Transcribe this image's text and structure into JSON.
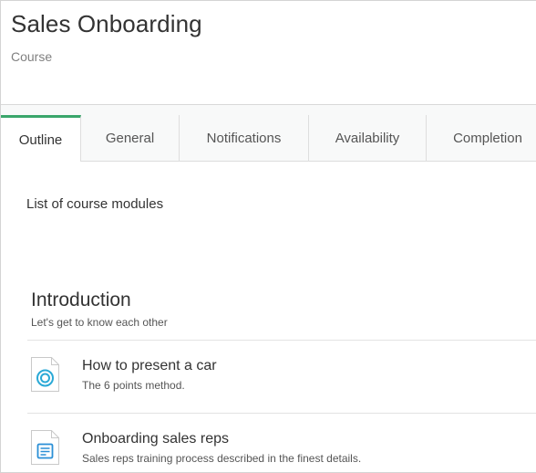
{
  "header": {
    "title": "Sales Onboarding",
    "subtitle": "Course"
  },
  "tabs": [
    {
      "label": "Outline",
      "active": true
    },
    {
      "label": "General",
      "active": false
    },
    {
      "label": "Notifications",
      "active": false
    },
    {
      "label": "Availability",
      "active": false
    },
    {
      "label": "Completion",
      "active": false
    }
  ],
  "colors": {
    "active_tab_accent": "#3aa66b",
    "icon_accent": "#2aa9d6"
  },
  "content": {
    "caption": "List of course modules",
    "section": {
      "title": "Introduction",
      "description": "Let's get to know each other",
      "modules": [
        {
          "title": "How to present a car",
          "description": "The 6 points method.",
          "icon": "circle-target-icon"
        },
        {
          "title": "Onboarding sales reps",
          "description": "Sales reps training process described in the finest details.",
          "icon": "document-text-icon"
        }
      ]
    }
  }
}
